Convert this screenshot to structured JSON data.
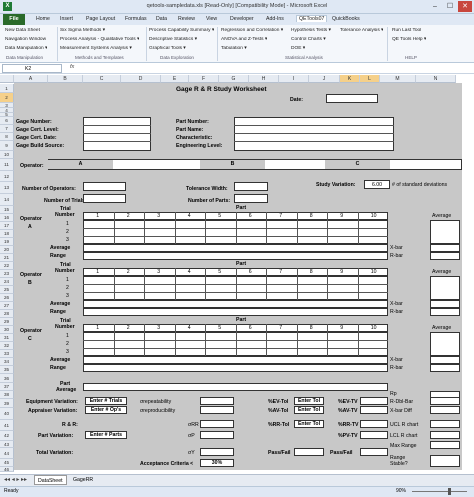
{
  "window": {
    "title": "qetools-sampledata.xls [Read-Only] [Compatibility Mode] - Microsoft Excel",
    "minimize": "–",
    "maximize": "☐",
    "close": "✕"
  },
  "ribbon_tabs": [
    "File",
    "Home",
    "Insert",
    "Page Layout",
    "Formulas",
    "Data",
    "Review",
    "View",
    "Developer",
    "Add-Ins",
    "QETools07",
    "QuickBooks"
  ],
  "ribbon": {
    "col1": [
      "New Data Sheet",
      "Navigation Window",
      "Data Manipulation ▾"
    ],
    "col2": [
      "Six Sigma Methods ▾",
      "Process Analysis - Qualitative Tools ▾",
      "Measurement Systems Analysis ▾"
    ],
    "col3": [
      "Process Capability Summary ▾",
      "Descriptive Statistics ▾",
      "Graphical Tools ▾"
    ],
    "col4": [
      "Regression and Correlation ▾",
      "ANOVA and Z-Tests ▾",
      "Tabulation ▾"
    ],
    "col5": [
      "Hypothesis Tests ▾",
      "Control Charts ▾",
      "DOE ▾"
    ],
    "col6": [
      "Tolerance Analysis ▾"
    ],
    "col7": [
      "Run Last Tool",
      "QE Tools Help ▾"
    ],
    "groups": [
      "Data Manipulation",
      "Methods and Templates",
      "Data Exploration",
      "Statistical Analysis",
      "HELP"
    ]
  },
  "formula_bar": {
    "cell": "K2",
    "fx": "fx"
  },
  "columns": [
    "A",
    "B",
    "C",
    "D",
    "E",
    "F",
    "G",
    "H",
    "I",
    "J",
    "K",
    "L",
    "M",
    "N"
  ],
  "rows": [
    "1",
    "2",
    "3",
    "4",
    "5",
    "6",
    "7",
    "8",
    "9",
    "10",
    "11",
    "12",
    "13",
    "14",
    "15",
    "16",
    "17",
    "18",
    "19",
    "20",
    "21",
    "22",
    "23",
    "24",
    "25",
    "26",
    "27",
    "28",
    "29",
    "30",
    "31",
    "32",
    "33",
    "34",
    "35",
    "36",
    "37",
    "38",
    "39",
    "40",
    "41",
    "42",
    "43",
    "44",
    "45",
    "46"
  ],
  "sheet": {
    "title": "Gage R & R Study Worksheet",
    "date_label": "Date:",
    "left_fields": [
      "Gage Number:",
      "Gage Cert. Level:",
      "Gage Cert. Date:",
      "Gage Build Source:"
    ],
    "right_fields": [
      "Part Number:",
      "Part Name:",
      "Characteristic:",
      "Engineering Level:"
    ],
    "operator_label": "Operator:",
    "operators": [
      "A",
      "B",
      "C"
    ],
    "num_operators": "Number of Operators:",
    "num_trials": "Number of Trials:",
    "tolerance_width": "Tolerance Width:",
    "num_parts": "Number of Parts:",
    "study_variation_label": "Study Variation:",
    "study_variation_value": "6.00",
    "study_variation_unit": "# of standard deviations",
    "operator_col": "Operator",
    "trial_number": "Trial",
    "trial_number2": "Number",
    "part": "Part",
    "part_numbers": [
      "1",
      "2",
      "3",
      "4",
      "5",
      "6",
      "7",
      "8",
      "9",
      "10"
    ],
    "average": "Average",
    "trials": [
      "1",
      "2",
      "3"
    ],
    "average_row": "Average",
    "range_row": "Range",
    "xbar": "X-bar",
    "rbar": "R-bar",
    "part_average": "Part",
    "part_average2": "Average",
    "rp": "Rp",
    "equip_variation": "Equipment Variation:",
    "appraiser_variation": "Appraiser Variation:",
    "rr": "R & R:",
    "part_variation": "Part Variation:",
    "total_variation": "Total Variation:",
    "enter_trials": "Enter # Trials",
    "enter_ops": "Enter # Op's",
    "enter_parts": "Enter # Parts",
    "sigma_rep": "σrepeatability",
    "sigma_repro": "σreproducibility",
    "sigma_rr": "σRR",
    "sigma_p": "σP",
    "sigma_y": "σY",
    "ev_tol": "%EV-Tol",
    "ev_tv": "%EV-TV",
    "av_tol": "%AV-Tol",
    "av_tv": "%AV-TV",
    "rr_tol": "%RR-Tol",
    "rr_tv": "%RR-TV",
    "pv_tv": "%PV-TV",
    "enter_tol": "Enter Tol",
    "acceptance": "Acceptance Criteria <",
    "acceptance_val": "30%",
    "pass_fail": "Pass/Fail",
    "r_dbl_bar": "R-Dbl-Bar",
    "xbar_diff": "X-bar Diff",
    "ucl_r": "UCL R chart",
    "lcl_r": "LCL R chart",
    "max_range": "Max Range",
    "range_stable": "Range",
    "range_stable2": "Stable?"
  },
  "sheet_tabs": [
    "DataSheet",
    "GageRR"
  ],
  "status": {
    "ready": "Ready",
    "zoom": "90%"
  }
}
